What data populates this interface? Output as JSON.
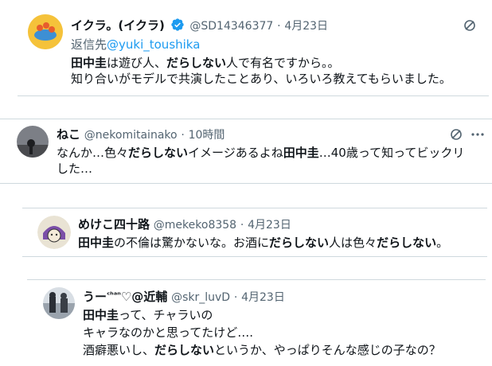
{
  "tweets": [
    {
      "name": "イクラ。(イクラ)",
      "handle": "@SD14346377",
      "time": "4月23日",
      "reply_label": "返信先",
      "reply_to": "@yuki_toushika",
      "lines": [
        [
          {
            "t": "田中圭",
            "b": true
          },
          {
            "t": "は遊び人、",
            "b": false
          },
          {
            "t": "だらしない",
            "b": true
          },
          {
            "t": "人で有名ですから。。",
            "b": false
          }
        ],
        [
          {
            "t": "知り合いがモデルで共演したことあり、いろいろ教えてもらいました。",
            "b": false
          }
        ]
      ]
    },
    {
      "name": "ねこ",
      "handle": "@nekomitainako",
      "time": "10時間",
      "lines": [
        [
          {
            "t": "なんか…色々",
            "b": false
          },
          {
            "t": "だらしない",
            "b": true
          },
          {
            "t": "イメージあるよね",
            "b": false
          },
          {
            "t": "田中圭",
            "b": true
          },
          {
            "t": "…40歳って知ってビックリ",
            "b": false
          }
        ],
        [
          {
            "t": "した…",
            "b": false
          }
        ]
      ]
    },
    {
      "name": "めけこ四十路",
      "handle": "@mekeko8358",
      "time": "4月23日",
      "lines": [
        [
          {
            "t": "田中圭",
            "b": true
          },
          {
            "t": "の不倫は驚かないな。お酒に",
            "b": false
          },
          {
            "t": "だらしない",
            "b": true
          },
          {
            "t": "人は色々",
            "b": false
          },
          {
            "t": "だらしない",
            "b": true
          },
          {
            "t": "。",
            "b": false
          }
        ]
      ]
    },
    {
      "name": "うー",
      "name_small": "ᶜʰᵃⁿ",
      "name_tail": "♡@近輔",
      "handle": "@skr_luvD",
      "time": "4月23日",
      "lines": [
        [
          {
            "t": "田中圭",
            "b": true
          },
          {
            "t": "って、チャラいの",
            "b": false
          }
        ],
        [
          {
            "t": "キャラなのかと思ってたけど….",
            "b": false
          }
        ],
        [
          {
            "t": "酒癖悪いし、",
            "b": false
          },
          {
            "t": "だらしない",
            "b": true
          },
          {
            "t": "というか、やっぱりそんな感じの子なの？",
            "b": false
          }
        ]
      ]
    }
  ],
  "separator": "·",
  "colors": {
    "text": "#0f1419",
    "muted": "#536471",
    "link": "#1d9bf0",
    "verified": "#1d9bf0",
    "border": "#cfd9de"
  },
  "icons": [
    "grok-icon",
    "more-icon",
    "verified-badge-icon"
  ]
}
